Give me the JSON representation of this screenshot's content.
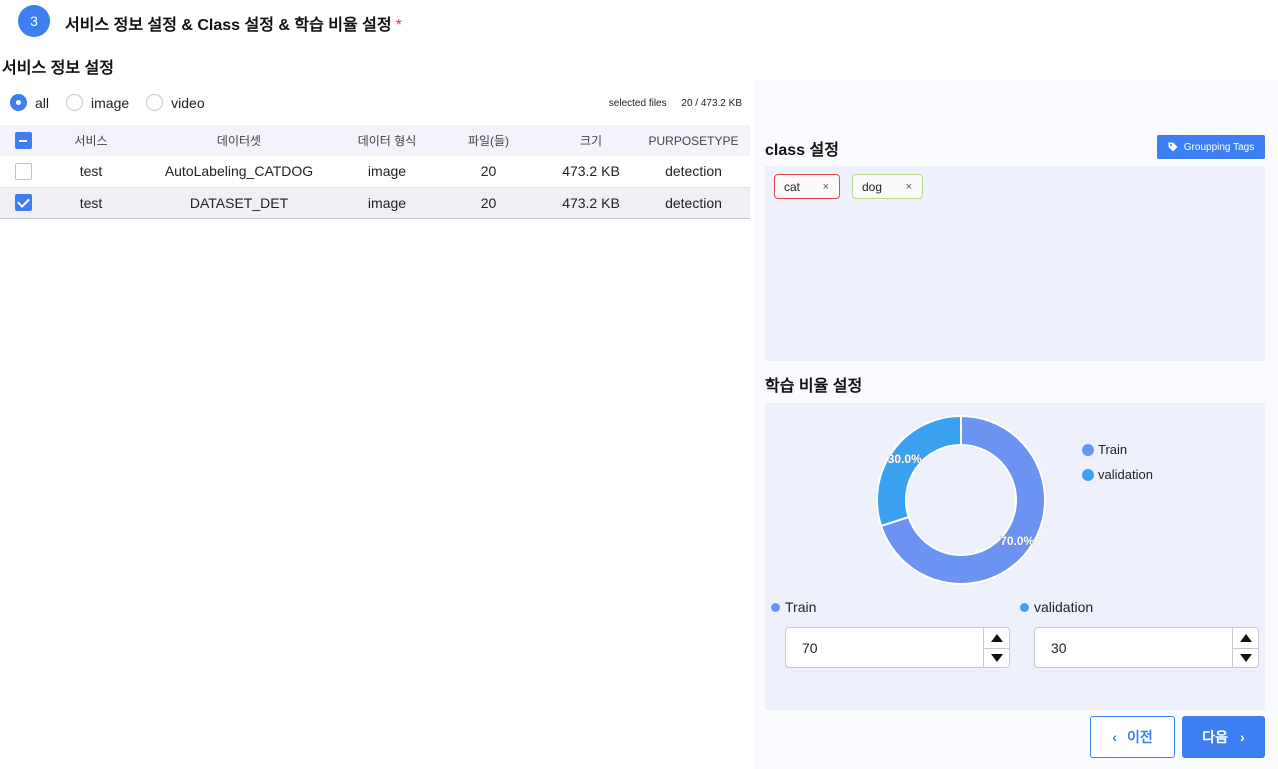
{
  "step": {
    "number": "3",
    "title": "서비스 정보 설정 & Class 설정 & 학습 비율 설정",
    "required_mark": "*"
  },
  "service_section": {
    "title": "서비스 정보 설정",
    "filters": [
      {
        "label": "all",
        "checked": true
      },
      {
        "label": "image",
        "checked": false
      },
      {
        "label": "video",
        "checked": false
      }
    ],
    "selected_files_label": "selected files",
    "selected_files_value": "20 / 473.2 KB"
  },
  "table": {
    "headers": [
      "서비스",
      "데이터셋",
      "데이터 형식",
      "파일(들)",
      "크기",
      "PURPOSETYPE"
    ],
    "rows": [
      {
        "checked": false,
        "service": "test",
        "dataset": "AutoLabeling_CATDOG",
        "format": "image",
        "files": "20",
        "size": "473.2 KB",
        "purpose": "detection"
      },
      {
        "checked": true,
        "service": "test",
        "dataset": "DATASET_DET",
        "format": "image",
        "files": "20",
        "size": "473.2 KB",
        "purpose": "detection"
      }
    ]
  },
  "class_section": {
    "title": "class 설정",
    "grouping_button": "Groupping Tags",
    "tags": [
      {
        "label": "cat",
        "remove": "×",
        "color": "#e0484e"
      },
      {
        "label": "dog",
        "remove": "×",
        "color": "#b9d98a"
      }
    ]
  },
  "ratio_section": {
    "title": "학습 비율 설정",
    "legend": [
      "Train",
      "validation"
    ],
    "train_label": "Train",
    "validation_label": "validation",
    "train_value": "70",
    "validation_value": "30"
  },
  "chart_data": {
    "type": "pie",
    "categories": [
      "Train",
      "validation"
    ],
    "values": [
      70,
      30
    ],
    "labels": [
      "70.0%",
      "30.0%"
    ],
    "colors": [
      "#6b93f2",
      "#3aa2f0"
    ],
    "legend": "top-right",
    "title": ""
  },
  "nav": {
    "prev_label": "이전",
    "next_label": "다음"
  },
  "colors": {
    "accent": "#3d7ef0",
    "train": "#6b93f2",
    "validation": "#3aa2f0"
  }
}
